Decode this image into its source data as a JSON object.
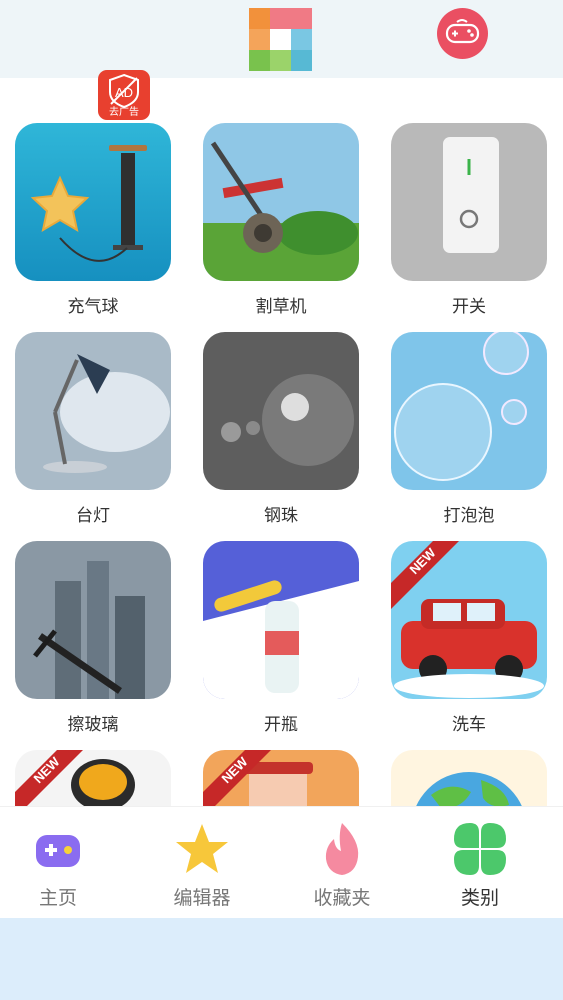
{
  "ad_badge": {
    "text": "AD",
    "caption": "去广告"
  },
  "apps": [
    {
      "label": "充气球",
      "icon": "balloon-pump"
    },
    {
      "label": "割草机",
      "icon": "lawn-mower"
    },
    {
      "label": "开关",
      "icon": "light-switch"
    },
    {
      "label": "台灯",
      "icon": "desk-lamp"
    },
    {
      "label": "钢珠",
      "icon": "steel-balls"
    },
    {
      "label": "打泡泡",
      "icon": "bubbles"
    },
    {
      "label": "擦玻璃",
      "icon": "window-squeegee"
    },
    {
      "label": "开瓶",
      "icon": "bottle-opener"
    },
    {
      "label": "洗车",
      "icon": "car-wash",
      "badge": "NEW"
    },
    {
      "label": "",
      "icon": "paint-bucket",
      "badge": "NEW"
    },
    {
      "label": "",
      "icon": "blender",
      "badge": "NEW"
    },
    {
      "label": "",
      "icon": "earth"
    }
  ],
  "tabs": [
    {
      "label": "主页",
      "icon": "gamepad-icon"
    },
    {
      "label": "编辑器",
      "icon": "star-icon"
    },
    {
      "label": "收藏夹",
      "icon": "flame-icon"
    },
    {
      "label": "类别",
      "icon": "clover-icon",
      "active": true
    }
  ],
  "colors": {
    "accent_red": "#ea4f62",
    "tab_text": "#777777",
    "active_tab_text": "#333333"
  }
}
